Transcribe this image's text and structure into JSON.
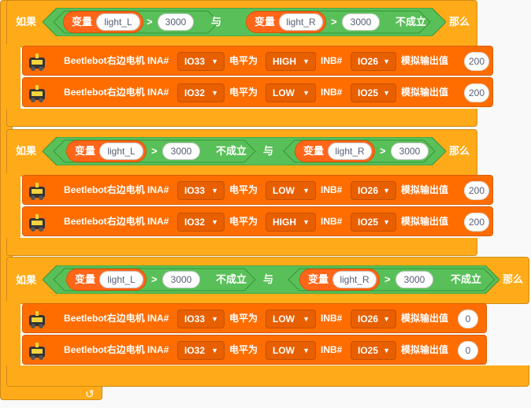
{
  "keywords": {
    "if": "如果",
    "then": "那么",
    "and": "与",
    "not_holds": "不成立",
    "var": "变量",
    "gt": ">"
  },
  "motor_labels": {
    "name": "Beetlebot右边电机 INA#",
    "level": "电平为",
    "inb": "INB#",
    "out": "模拟输出值"
  },
  "blocks": [
    {
      "cond_left": {
        "var": "light_L",
        "value": "3000"
      },
      "cond_right": {
        "var": "light_R",
        "value": "3000"
      },
      "motors": [
        {
          "ina": "IO33",
          "level": "HIGH",
          "inb": "IO26",
          "value": "200"
        },
        {
          "ina": "IO32",
          "level": "LOW",
          "inb": "IO25",
          "value": "200"
        }
      ]
    },
    {
      "cond_left": {
        "var": "light_L",
        "value": "3000"
      },
      "cond_right": {
        "var": "light_R",
        "value": "3000"
      },
      "motors": [
        {
          "ina": "IO33",
          "level": "LOW",
          "inb": "IO26",
          "value": "200"
        },
        {
          "ina": "IO32",
          "level": "HIGH",
          "inb": "IO25",
          "value": "200"
        }
      ]
    },
    {
      "cond_left": {
        "var": "light_L",
        "value": "3000"
      },
      "cond_right": {
        "var": "light_R",
        "value": "3000"
      },
      "motors": [
        {
          "ina": "IO33",
          "level": "LOW",
          "inb": "IO26",
          "value": "0"
        },
        {
          "ina": "IO32",
          "level": "LOW",
          "inb": "IO25",
          "value": "0"
        }
      ]
    }
  ],
  "colors": {
    "control": "#FFAB19",
    "operator": "#59C059",
    "variable": "#FF661A",
    "motor": "#FF6D00"
  },
  "icons": {
    "loop_end": "loop-arrow-icon",
    "robot": "robot-icon"
  }
}
